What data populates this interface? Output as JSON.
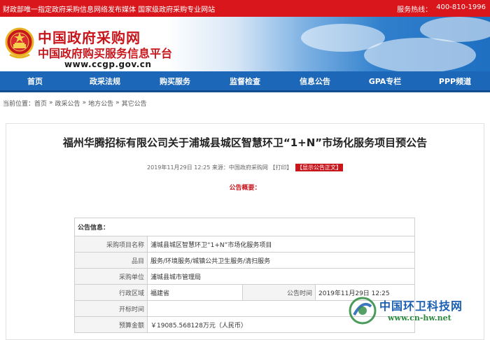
{
  "topbar": {
    "left_text": "财政部唯一指定政府采购信息网络发布媒体 国家级政府采购专业网站",
    "hotline_label": "服务热线：",
    "hotline_number": "400-810-1996"
  },
  "banner": {
    "title_line1": "中国政府采购网",
    "title_line2": "中国政府购买服务信息平台",
    "url": "www.ccgp.gov.cn"
  },
  "nav": {
    "items": [
      "首页",
      "政采法规",
      "购买服务",
      "监督检查",
      "信息公告",
      "GPA专栏",
      "PPP频道"
    ]
  },
  "breadcrumb": {
    "prefix": "当前位置：",
    "items": [
      "首页",
      "政采公告",
      "地方公告",
      "其它公告"
    ],
    "separator": "»"
  },
  "article": {
    "title": "福州华腾招标有限公司关于浦城县城区智慧环卫“1+N”市场化服务项目预公告",
    "meta_text": "2019年11月29日 12:25 来源：中国政府采购网 【打印】",
    "show_text_button": "【显示公告正文】",
    "summary_heading": "公告概要："
  },
  "info_table": {
    "header": "公告信息：",
    "rows": [
      {
        "label": "采购项目名称",
        "value": "浦城县城区智慧环卫“1+N”市场化服务项目"
      },
      {
        "label": "品目",
        "value": "服务/环境服务/城镇公共卫生服务/清扫服务"
      },
      {
        "label": "采购单位",
        "value": "浦城县城市管理局"
      },
      {
        "label": "行政区域",
        "value": "福建省",
        "label2": "公告时间",
        "value2": "2019年11月29日 12:25"
      },
      {
        "label": "开标时间",
        "value": ""
      },
      {
        "label": "预算金额",
        "value": "￥19085.568128万元（人民币）"
      }
    ]
  },
  "watermark": {
    "name": "中国环卫科技网",
    "url": "www.cn-hw.net"
  },
  "colors": {
    "topbar": "#d9161c",
    "nav": "#1c67b8",
    "title_red": "#c8161d"
  }
}
